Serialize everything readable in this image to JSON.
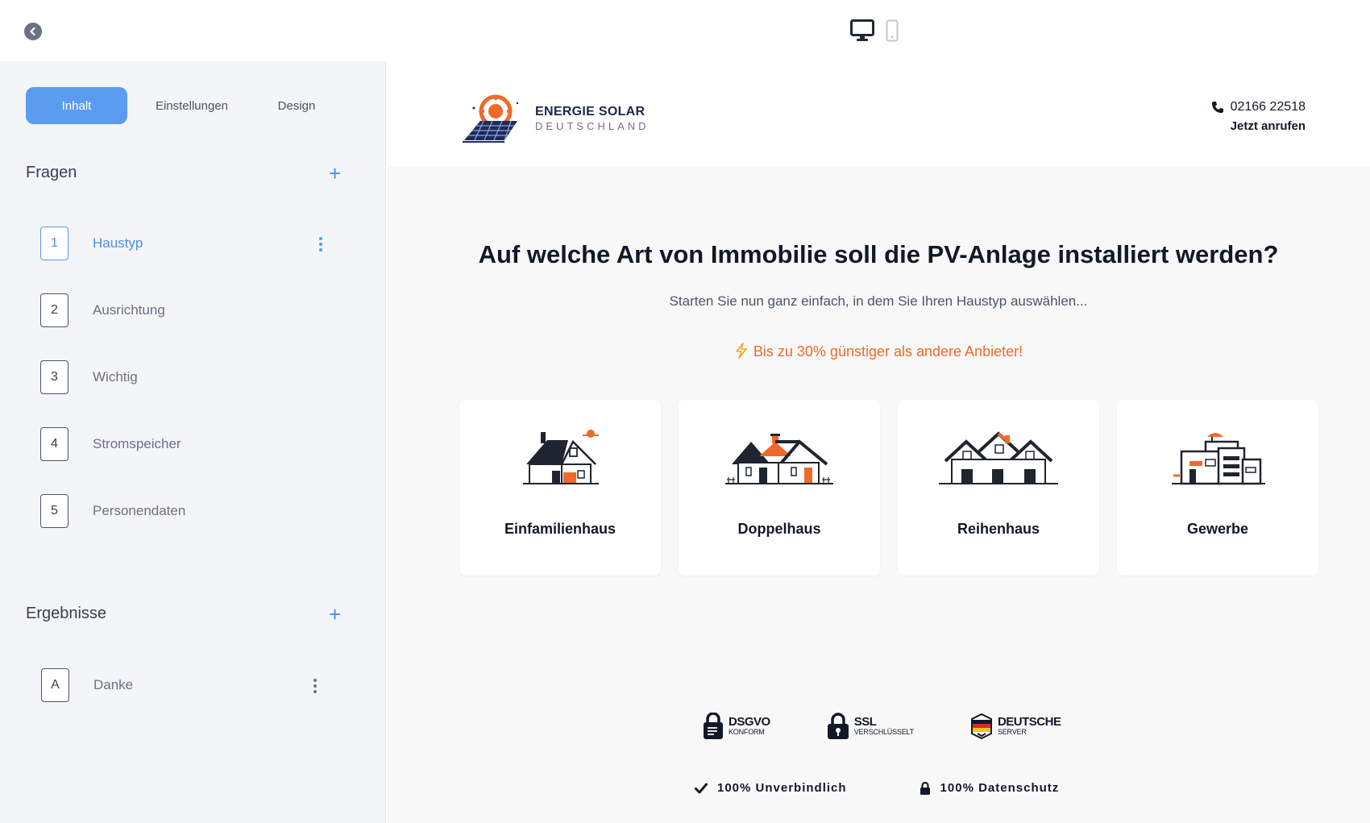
{
  "editor": {
    "tabs": [
      {
        "label": "Inhalt"
      },
      {
        "label": "Einstellungen"
      },
      {
        "label": "Design"
      }
    ],
    "questions_title": "Fragen",
    "questions": [
      {
        "num": "1",
        "label": "Haustyp"
      },
      {
        "num": "2",
        "label": "Ausrichtung"
      },
      {
        "num": "3",
        "label": "Wichtig"
      },
      {
        "num": "4",
        "label": "Stromspeicher"
      },
      {
        "num": "5",
        "label": "Personendaten"
      }
    ],
    "results_title": "Ergebnisse",
    "results": [
      {
        "num": "A",
        "label": "Danke"
      }
    ]
  },
  "site": {
    "logo_title": "ENERGIE SOLAR",
    "logo_sub": "DEUTSCHLAND",
    "phone": "02166 22518",
    "call_label": "Jetzt anrufen",
    "headline": "Auf welche Art von Immobilie soll die PV-Anlage installiert werden?",
    "subline": "Starten Sie nun ganz einfach, in dem Sie Ihren Haustyp auswählen...",
    "promo": "Bis zu 30% günstiger als andere Anbieter!",
    "options": [
      {
        "label": "Einfamilienhaus"
      },
      {
        "label": "Doppelhaus"
      },
      {
        "label": "Reihenhaus"
      },
      {
        "label": "Gewerbe"
      }
    ],
    "badges": [
      {
        "title": "DSGVO",
        "sub": "KONFORM"
      },
      {
        "title": "SSL",
        "sub": "VERSCHLÜSSELT"
      },
      {
        "title": "DEUTSCHE",
        "sub": "SERVER"
      }
    ],
    "guarantees": [
      {
        "label": "100% Unverbindlich"
      },
      {
        "label": "100% Datenschutz"
      }
    ]
  },
  "colors": {
    "accent": "#5b9bf0",
    "brand_orange": "#ef6a2a",
    "dark": "#111827"
  }
}
